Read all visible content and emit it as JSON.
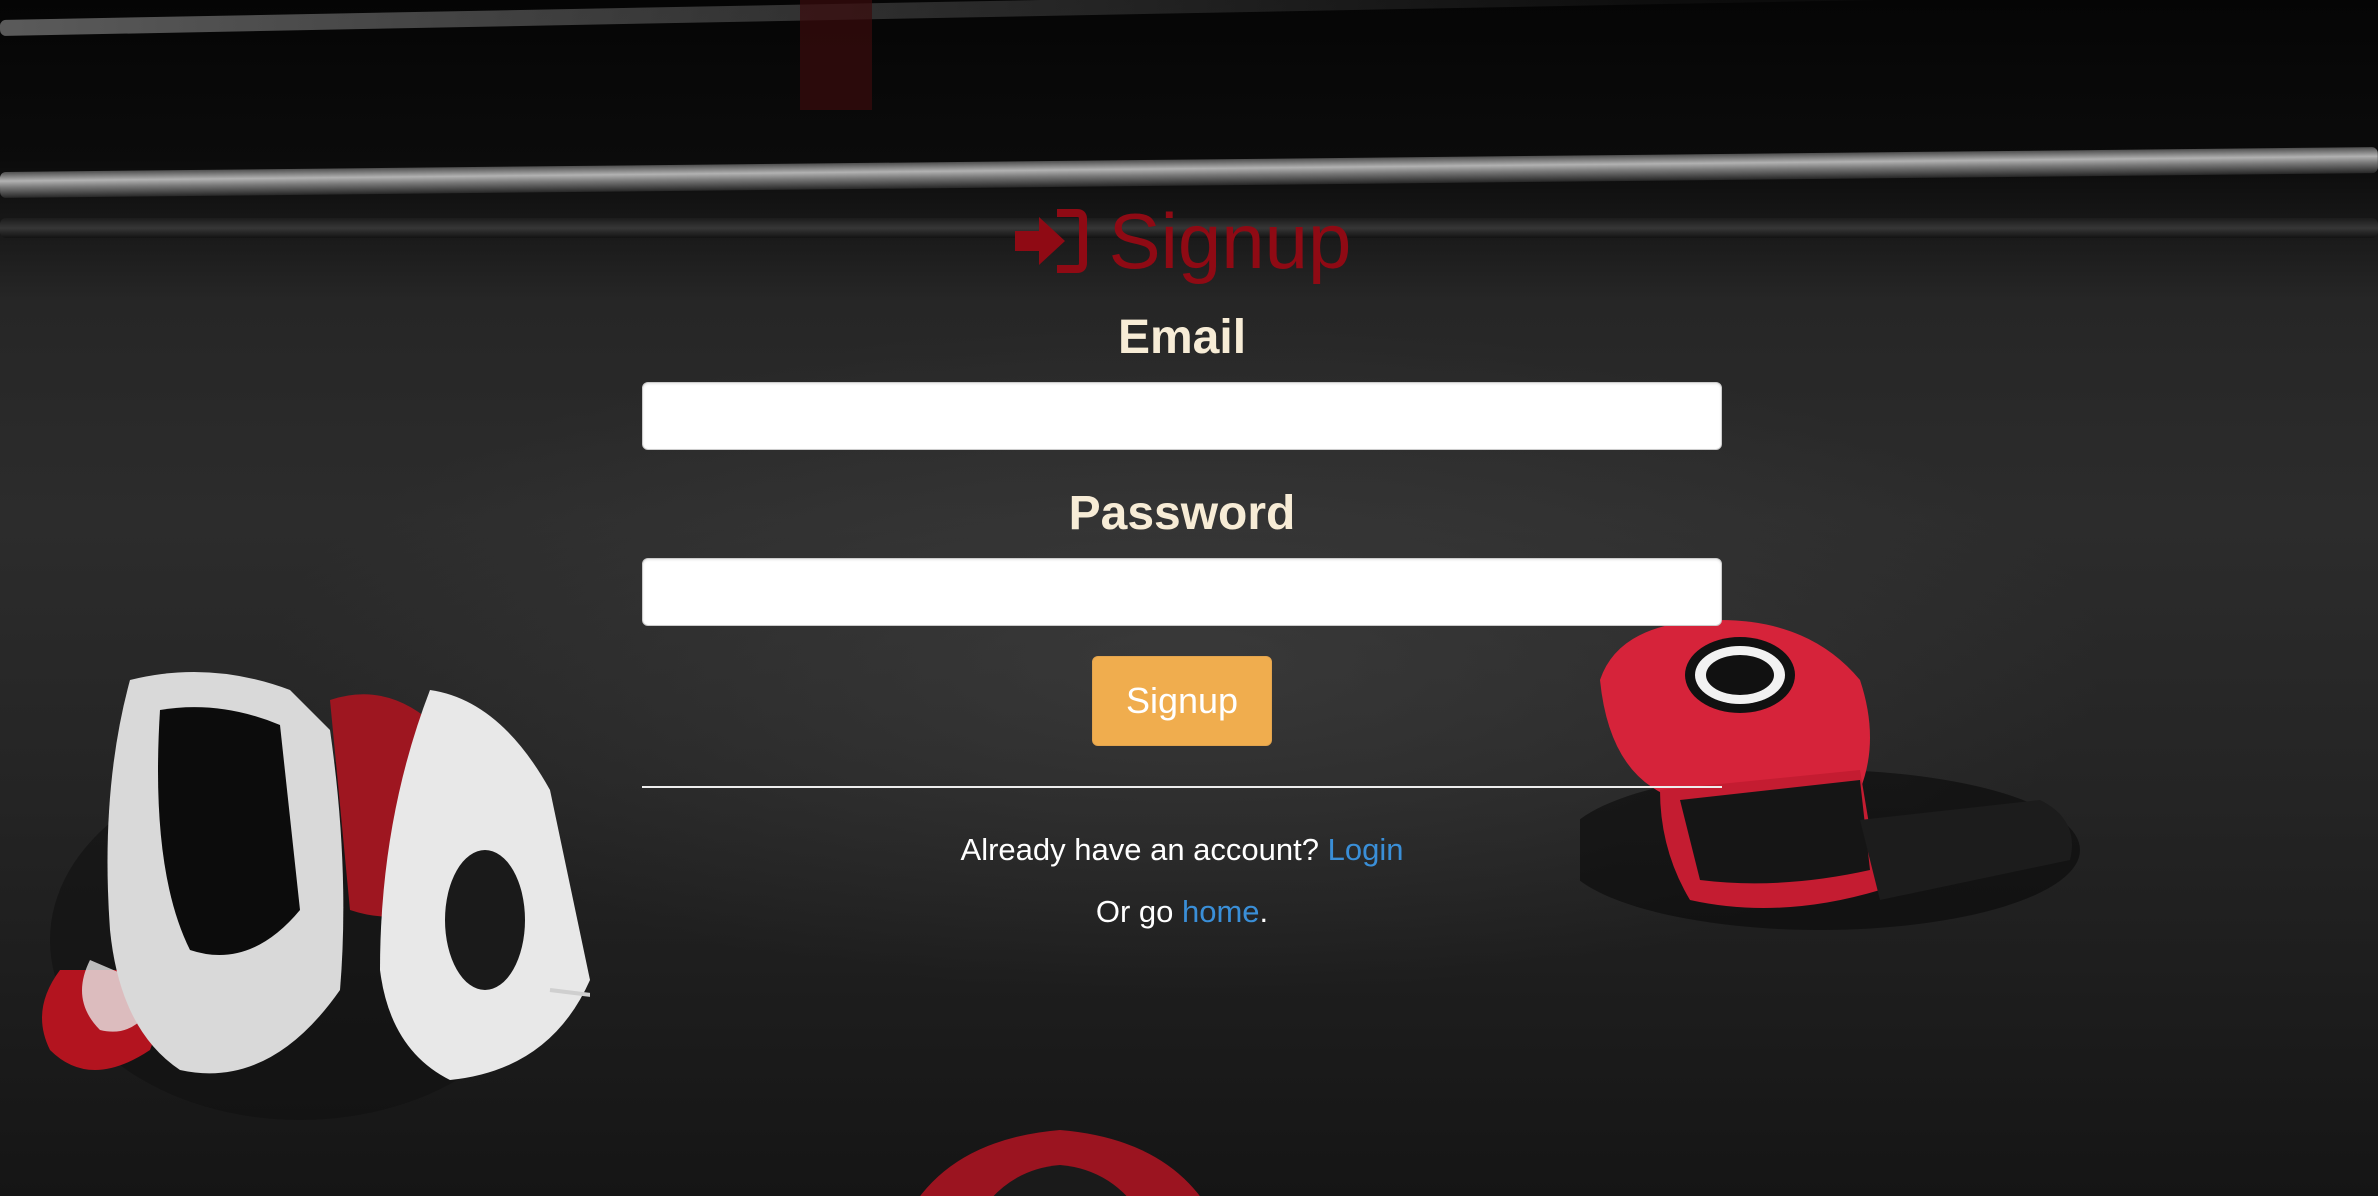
{
  "page": {
    "title": "Signup"
  },
  "form": {
    "email_label": "Email",
    "email_value": "",
    "password_label": "Password",
    "password_value": "",
    "submit_label": "Signup"
  },
  "footer": {
    "login_prompt": "Already have an account?",
    "login_link": "Login",
    "home_prefix": "Or go",
    "home_link": "home",
    "home_suffix": "."
  },
  "icons": {
    "title_icon": "sign-in-icon"
  },
  "colors": {
    "title": "#8f0a14",
    "label": "#f7ecd6",
    "button": "#f0ad4e",
    "link": "#3a8fd8"
  }
}
